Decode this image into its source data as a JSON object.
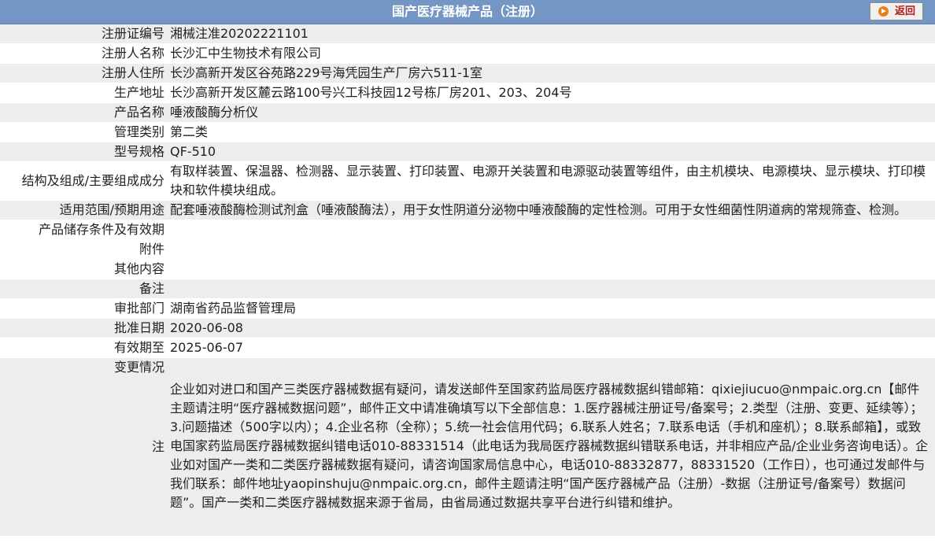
{
  "header": {
    "title": "国产医疗器械产品（注册）",
    "back_label": "返回"
  },
  "rows": [
    {
      "label": "注册证编号",
      "value": "湘械注准20202221101"
    },
    {
      "label": "注册人名称",
      "value": "长沙汇中生物技术有限公司"
    },
    {
      "label": "注册人住所",
      "value": "长沙高新开发区谷苑路229号海凭园生产厂房六511-1室"
    },
    {
      "label": "生产地址",
      "value": "长沙高新开发区麓云路100号兴工科技园12号栋厂房201、203、204号"
    },
    {
      "label": "产品名称",
      "value": "唾液酸酶分析仪"
    },
    {
      "label": "管理类别",
      "value": "第二类"
    },
    {
      "label": "型号规格",
      "value": "QF-510"
    },
    {
      "label": "结构及组成/主要组成成分",
      "value": "有取样装置、保温器、检测器、显示装置、打印装置、电源开关装置和电源驱动装置等组件，由主机模块、电源模块、显示模块、打印模块和软件模块组成。"
    },
    {
      "label": "适用范围/预期用途",
      "value": "配套唾液酸酶检测试剂盒（唾液酸酶法），用于女性阴道分泌物中唾液酸酶的定性检测。可用于女性细菌性阴道病的常规筛查、检测。"
    },
    {
      "label": "产品储存条件及有效期",
      "value": ""
    },
    {
      "label": "附件",
      "value": ""
    },
    {
      "label": "其他内容",
      "value": ""
    },
    {
      "label": "备注",
      "value": ""
    },
    {
      "label": "审批部门",
      "value": "湖南省药品监督管理局"
    },
    {
      "label": "批准日期",
      "value": "2020-06-08"
    },
    {
      "label": "有效期至",
      "value": "2025-06-07"
    }
  ],
  "change": {
    "label": "变更情况",
    "value": ""
  },
  "note": {
    "label": "注",
    "value": "企业如对进口和国产三类医疗器械数据有疑问，请发送邮件至国家药监局医疗器械数据纠错邮箱：qixiejiucuo@nmpaic.org.cn【邮件主题请注明“医疗器械数据问题”，邮件正文中请准确填写以下全部信息：1.医疗器械注册证号/备案号；2.类型（注册、变更、延续等）；3.问题描述（500字以内）；4.企业名称（全称）；5.统一社会信用代码；6.联系人姓名；7.联系电话（手机和座机）；8.联系邮箱】，或致电国家药监局医疗器械数据纠错电话010-88331514（此电话为我局医疗器械数据纠错联系电话，并非相应产品/企业业务咨询电话）。企业如对国产一类和二类医疗器械数据有疑问，请咨询国家局信息中心，电话010-88332877，88331520（工作日），也可通过发邮件与我们联系：邮件地址yaopinshuju@nmpaic.org.cn，邮件主题请注明“国产医疗器械产品（注册）-数据（注册证号/备案号）数据问题”。国产一类和二类医疗器械数据来源于省局，由省局通过数据共享平台进行纠错和维护。"
  }
}
